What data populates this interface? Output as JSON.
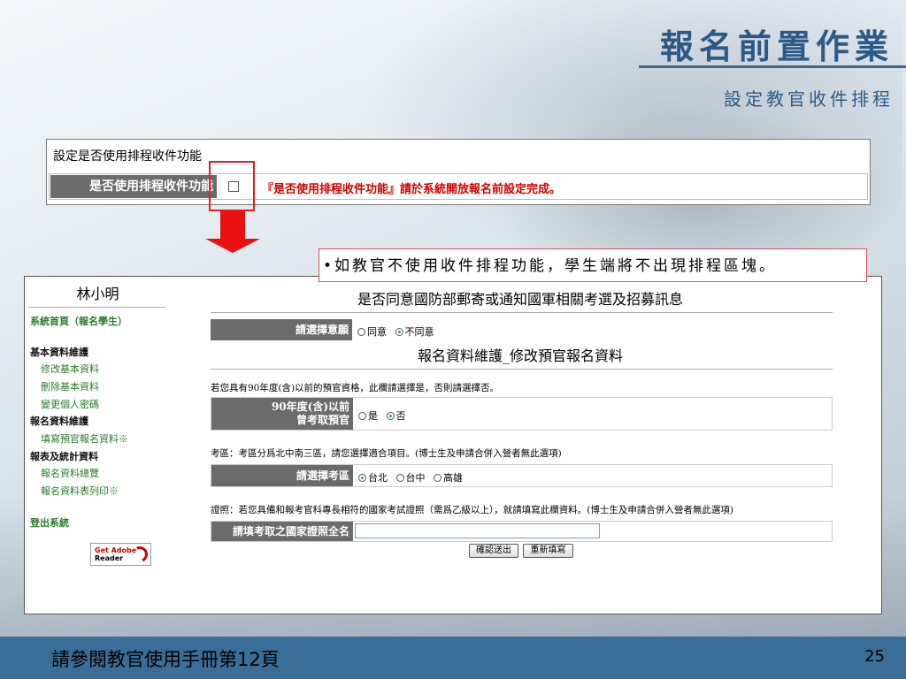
{
  "slide": {
    "title": "報名前置作業",
    "subtitle": "設定教官收件排程",
    "footer_text": "請參閱教官使用手冊第12頁",
    "page_number": "25",
    "callout": "•如教官不使用收件排程功能，學生端將不出現排程區塊。"
  },
  "setting": {
    "heading": "設定是否使用排程收件功能",
    "label": "是否使用排程收件功能",
    "note": "『是否使用排程收件功能』請於系統開放報名前設定完成。",
    "checked": false
  },
  "sidebar": {
    "user": "林小明",
    "home": "系統首頁（報名學生）",
    "sections": [
      {
        "title": "基本資料維護",
        "items": [
          "修改基本資料",
          "刪除基本資料",
          "變更個人密碼"
        ]
      },
      {
        "title": "報名資料維護",
        "items": [
          "填寫預官報名資料※"
        ]
      },
      {
        "title": "報表及統計資料",
        "items": [
          "報名資料總覽",
          "報名資料表列印※"
        ]
      }
    ],
    "logout": "登出系統",
    "adobe": {
      "line1": "Get Adobe",
      "line2": "Reader"
    }
  },
  "main": {
    "consent_title": "是否同意國防部郵寄或通知國軍相關考選及招募訊息",
    "consent_label": "請選擇意願",
    "consent_options": [
      "同意",
      "不同意"
    ],
    "consent_selected": "不同意",
    "form_title": "報名資料維護_修改預官報名資料",
    "prior_note": "若您具有90年度(含)以前的預官資格，此欄請選擇是，否則請選擇否。",
    "prior_label_1": "90年度(含)以前",
    "prior_label_2": "曾考取預官",
    "prior_options": [
      "是",
      "否"
    ],
    "prior_selected": "否",
    "region_note": "考區：考區分爲北中南三區，請您選擇適合項目。(博士生及申請合併入營者無此選項)",
    "region_label": "請選擇考區",
    "region_options": [
      "台北",
      "台中",
      "高雄"
    ],
    "region_selected": "台北",
    "license_note": "證照：若您具備和報考官科專長相符的國家考試證照（需爲乙級以上），就請填寫此欄資料。(博士生及申請合併入營者無此選項)",
    "license_label": "請填考取之國家證照全名",
    "license_value": "",
    "submit_label": "確認送出",
    "reset_label": "重新填寫"
  }
}
